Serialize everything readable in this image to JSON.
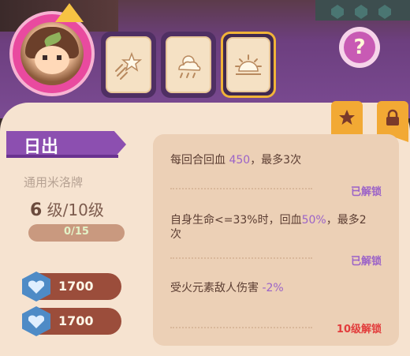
{
  "skill": {
    "name": "日出",
    "type_label": "通用米洛牌",
    "level_current": "6",
    "level_suffix": " 级/10级",
    "progress_text": "0/15",
    "progress_fraction": 0.0
  },
  "tabs": [
    {
      "icon": "shooting-star-icon",
      "active": false
    },
    {
      "icon": "cloud-sun-icon",
      "active": false
    },
    {
      "icon": "sunrise-icon",
      "active": true
    }
  ],
  "help_label": "?",
  "costs": [
    {
      "icon": "heart-gem-icon",
      "value": "1700"
    },
    {
      "icon": "heart-gem-icon",
      "value": "1700"
    }
  ],
  "effects": [
    {
      "text_a": "每回合回血 ",
      "hl": "450",
      "text_b": "，最多3次",
      "status": "已解锁",
      "status_type": "unlocked"
    },
    {
      "text_a": "自身生命<=33%时，回血",
      "hl": "50%",
      "text_b": "，最多2次",
      "status": "已解锁",
      "status_type": "unlocked"
    },
    {
      "text_a": "受火元素敌人伤害 ",
      "hl": "-2%",
      "text_b": "",
      "status": "10级解锁",
      "status_type": "locked"
    }
  ],
  "colors": {
    "accent_purple": "#8c4fb0",
    "unlocked": "#9b63c8",
    "locked": "#e23c3c",
    "card_bg": "#f6e3d0"
  }
}
